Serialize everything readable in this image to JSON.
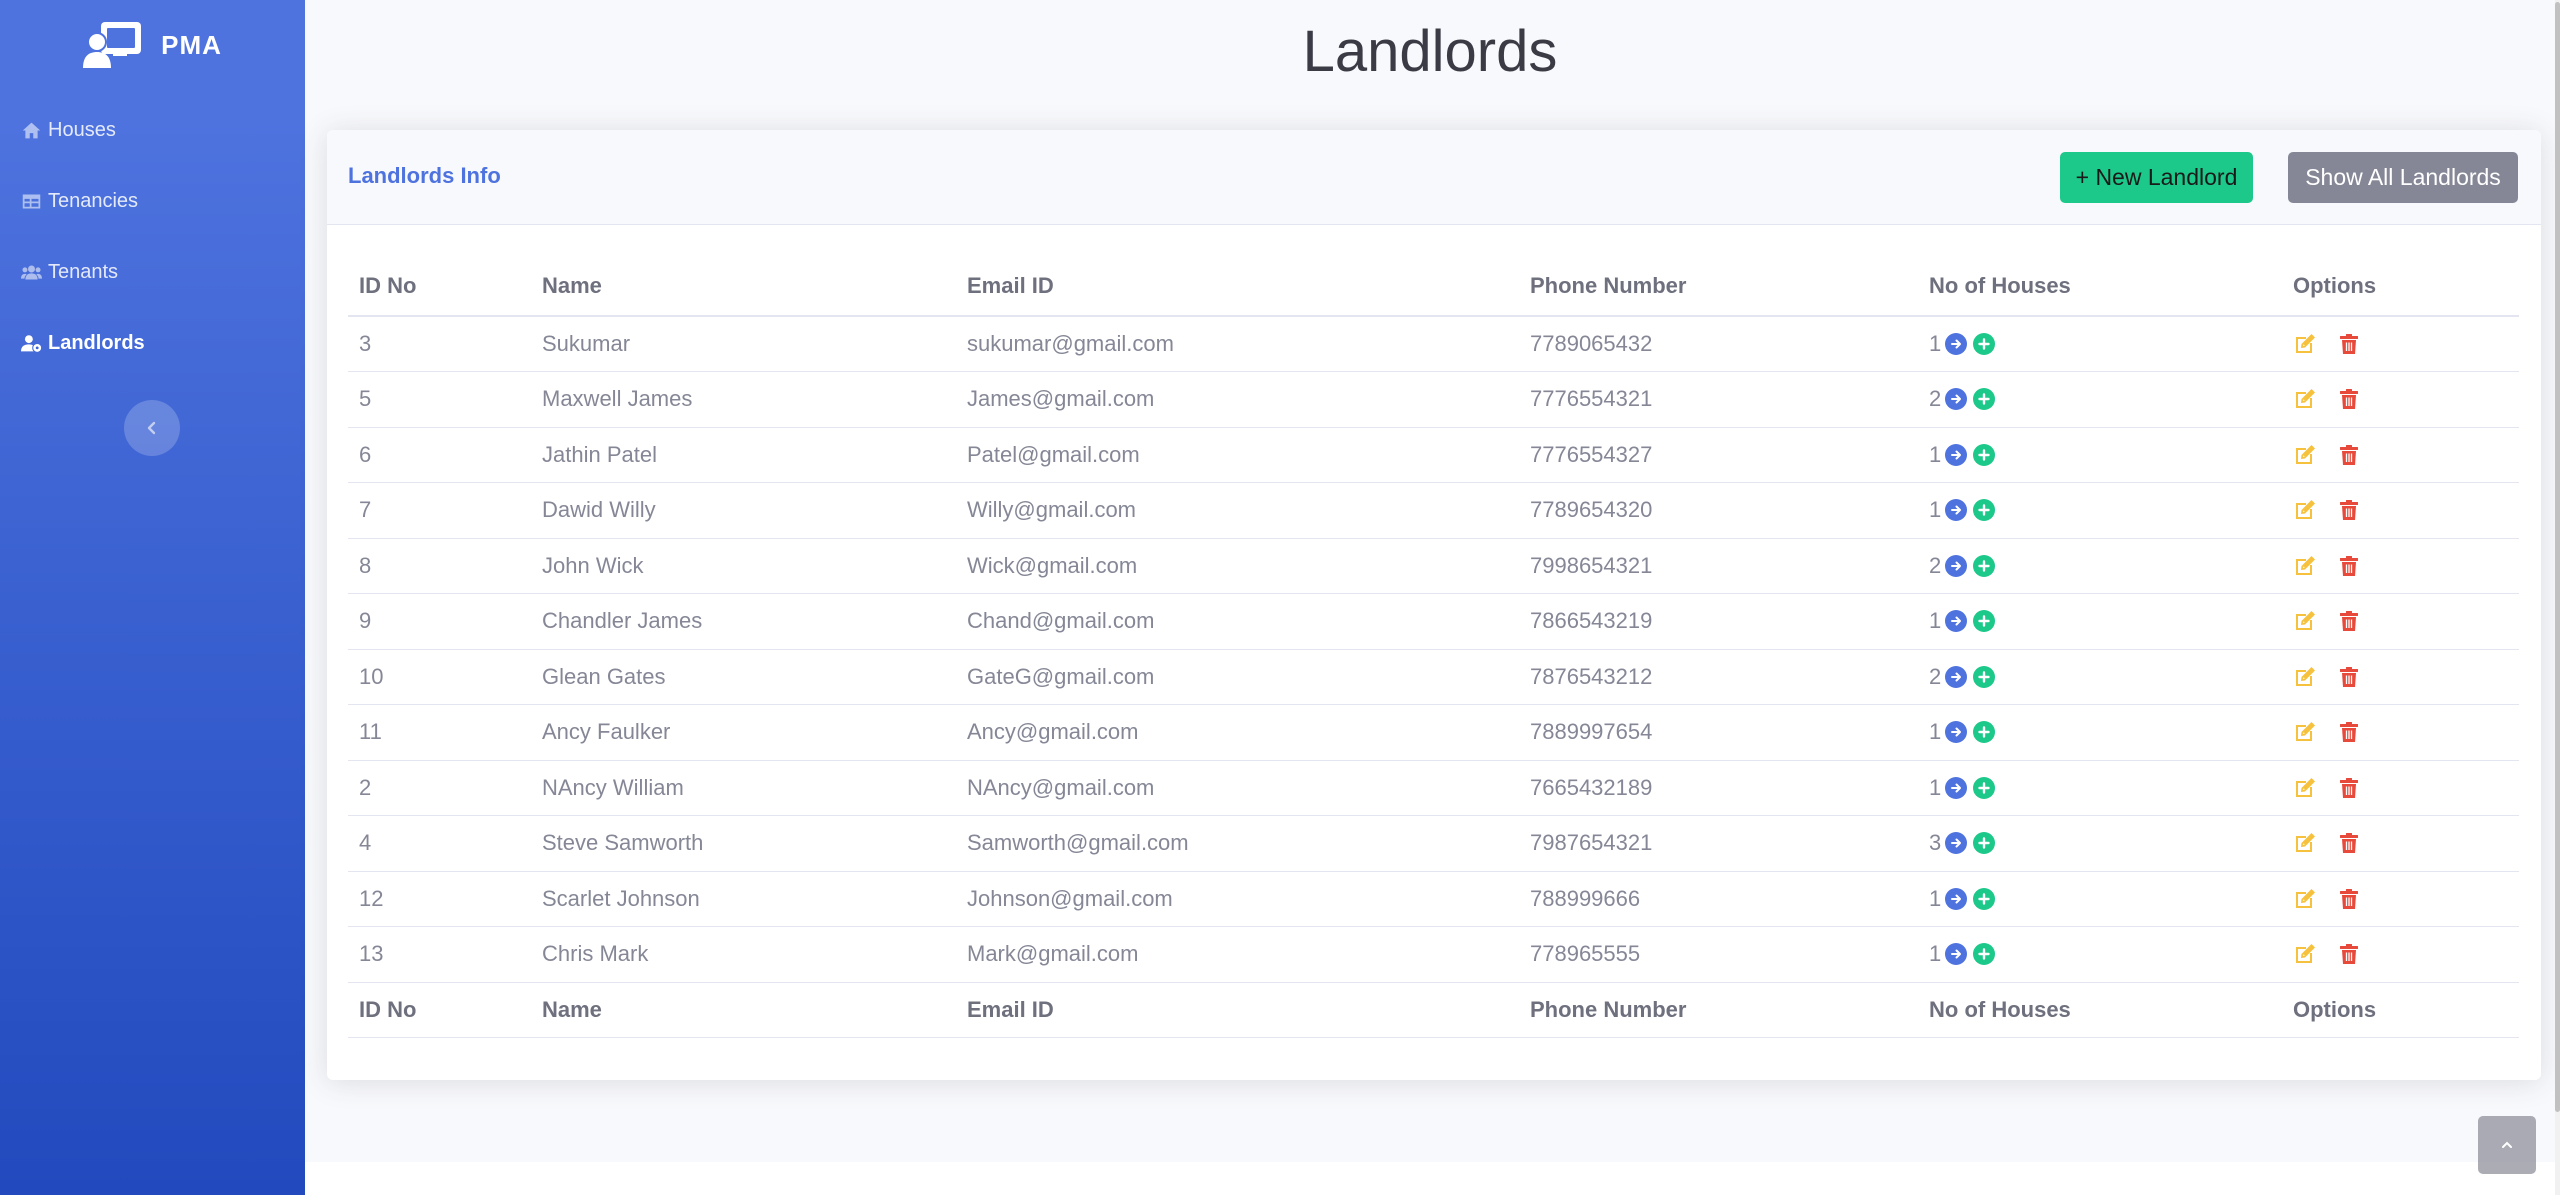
{
  "brand": {
    "name": "PMA",
    "icon": "chalkboard-user-icon"
  },
  "sidebar": {
    "items": [
      {
        "label": "Houses",
        "icon": "home-icon",
        "active": false
      },
      {
        "label": "Tenancies",
        "icon": "table-icon",
        "active": false
      },
      {
        "label": "Tenants",
        "icon": "users-icon",
        "active": false
      },
      {
        "label": "Landlords",
        "icon": "user-cog-icon",
        "active": true
      }
    ],
    "toggle_icon": "chevron-left-icon"
  },
  "page": {
    "title": "Landlords"
  },
  "card": {
    "title": "Landlords Info",
    "new_button": "+ New Landlord",
    "show_all_button": "Show All Landlords"
  },
  "table": {
    "columns": [
      "ID No",
      "Name",
      "Email ID",
      "Phone Number",
      "No of Houses",
      "Options"
    ],
    "rows": [
      {
        "id": "3",
        "name": "Sukumar",
        "email": "sukumar@gmail.com",
        "phone": "7789065432",
        "houses": "1"
      },
      {
        "id": "5",
        "name": "Maxwell James",
        "email": "James@gmail.com",
        "phone": "7776554321",
        "houses": "2"
      },
      {
        "id": "6",
        "name": "Jathin Patel",
        "email": "Patel@gmail.com",
        "phone": "7776554327",
        "houses": "1"
      },
      {
        "id": "7",
        "name": "Dawid Willy",
        "email": "Willy@gmail.com",
        "phone": "7789654320",
        "houses": "1"
      },
      {
        "id": "8",
        "name": "John Wick",
        "email": "Wick@gmail.com",
        "phone": "7998654321",
        "houses": "2"
      },
      {
        "id": "9",
        "name": "Chandler James",
        "email": "Chand@gmail.com",
        "phone": "7866543219",
        "houses": "1"
      },
      {
        "id": "10",
        "name": "Glean Gates",
        "email": "GateG@gmail.com",
        "phone": "7876543212",
        "houses": "2"
      },
      {
        "id": "11",
        "name": "Ancy Faulker",
        "email": "Ancy@gmail.com",
        "phone": "7889997654",
        "houses": "1"
      },
      {
        "id": "2",
        "name": "NAncy William",
        "email": "NAncy@gmail.com",
        "phone": "7665432189",
        "houses": "1"
      },
      {
        "id": "4",
        "name": "Steve Samworth",
        "email": "Samworth@gmail.com",
        "phone": "7987654321",
        "houses": "3"
      },
      {
        "id": "12",
        "name": "Scarlet Johnson",
        "email": "Johnson@gmail.com",
        "phone": "788999666",
        "houses": "1"
      },
      {
        "id": "13",
        "name": "Chris Mark",
        "email": "Mark@gmail.com",
        "phone": "778965555",
        "houses": "1"
      }
    ]
  },
  "colors": {
    "primary": "#4e73df",
    "success": "#1cc88a",
    "secondary": "#858796",
    "warning": "#f6c23e",
    "danger": "#e74a3b"
  }
}
